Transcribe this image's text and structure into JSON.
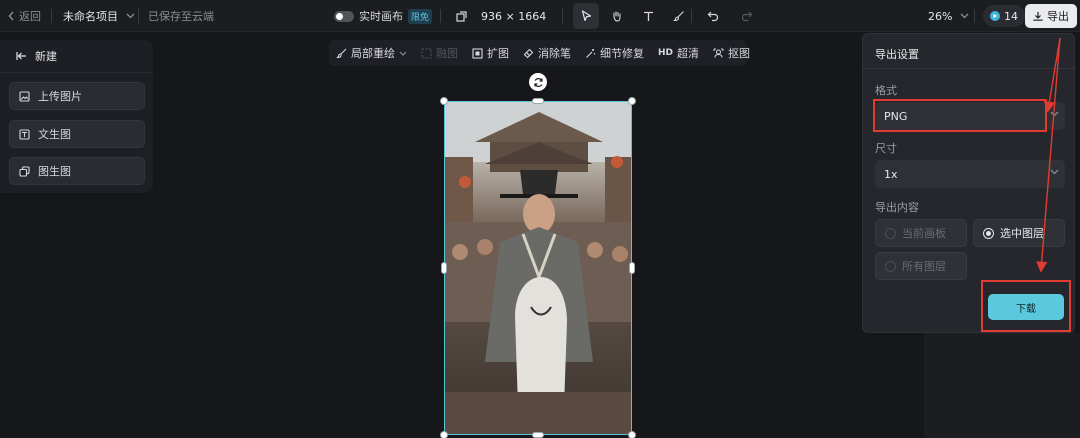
{
  "topbar": {
    "back_label": "返回",
    "project_name": "未命名项目",
    "save_status": "已保存至云端",
    "realtime_label": "实时画布",
    "free_badge": "限免",
    "canvas_size": "936 × 1664",
    "zoom": "26%",
    "credits": "14",
    "export_label": "导出"
  },
  "left_panel": {
    "new_label": "新建",
    "items": [
      {
        "label": "上传图片",
        "icon": "upload-image-icon"
      },
      {
        "label": "文生图",
        "icon": "text-to-image-icon"
      },
      {
        "label": "图生图",
        "icon": "image-to-image-icon"
      }
    ]
  },
  "edit_toolbar": {
    "items": [
      {
        "label": "局部重绘",
        "icon": "brush-icon",
        "disabled": false
      },
      {
        "label": "融图",
        "icon": "merge-icon",
        "disabled": true
      },
      {
        "label": "扩图",
        "icon": "expand-icon",
        "disabled": false
      },
      {
        "label": "消除笔",
        "icon": "eraser-icon",
        "disabled": false
      },
      {
        "label": "细节修复",
        "icon": "magic-wand-icon",
        "disabled": false
      },
      {
        "label": "超清",
        "icon": "hd-icon",
        "disabled": false
      },
      {
        "label": "抠图",
        "icon": "cutout-icon",
        "disabled": false
      }
    ]
  },
  "export_panel": {
    "title": "导出设置",
    "format_label": "格式",
    "format_value": "PNG",
    "size_label": "尺寸",
    "size_value": "1x",
    "content_label": "导出内容",
    "options": [
      {
        "label": "当前画板",
        "selected": false
      },
      {
        "label": "选中图层",
        "selected": true
      },
      {
        "label": "所有图层",
        "selected": false
      }
    ],
    "download_label": "下载"
  },
  "colors": {
    "accent": "#5ac8dd",
    "annotation_red": "#e03c31",
    "background": "#16171b"
  }
}
